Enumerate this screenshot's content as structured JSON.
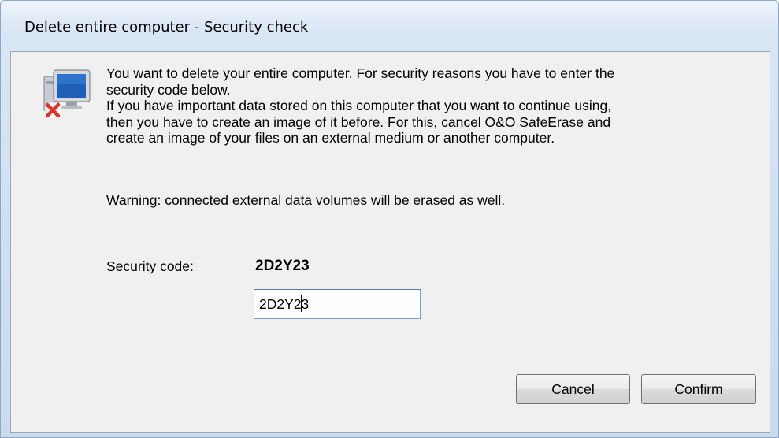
{
  "window": {
    "title": "Delete entire computer - Security check"
  },
  "dialog": {
    "icon": "computer-delete-icon",
    "message": {
      "line1": "You want to delete your entire computer. For security reasons you have to enter the",
      "line2": "security code below.",
      "line3": "If you have important data stored on this computer that you want to continue using,",
      "line4": "then you have to create an image of it before. For this, cancel O&O SafeErase and",
      "line5": "create an image of your files on an external medium or another computer."
    },
    "warning": "Warning: connected external data volumes will be erased as well.",
    "security_code_label": "Security code:",
    "security_code_value": "2D2Y23",
    "security_code_input": "2D2Y23"
  },
  "buttons": {
    "cancel_label": "Cancel",
    "confirm_label": "Confirm"
  },
  "colors": {
    "icon_x": "#d9352b",
    "screen": "#1f5fb8",
    "client_bg": "#f0f0f0"
  }
}
